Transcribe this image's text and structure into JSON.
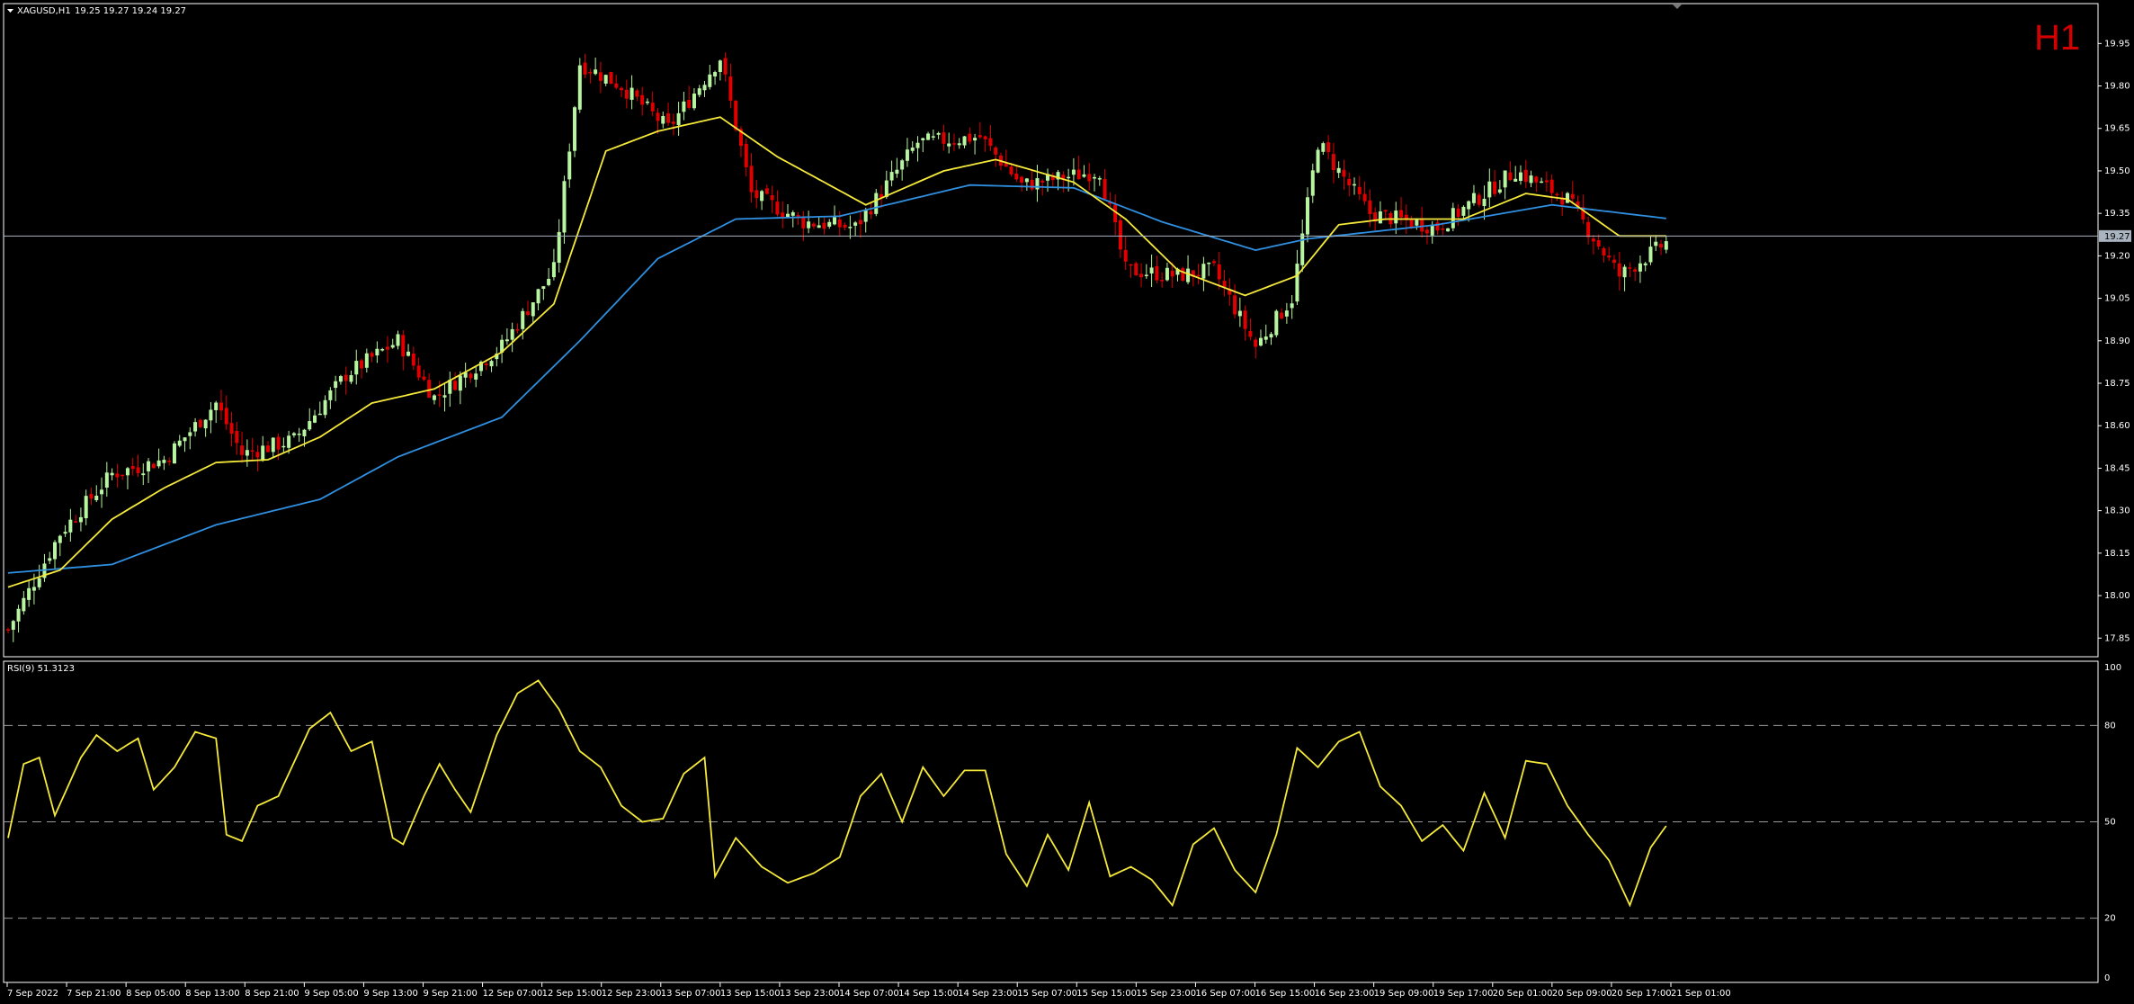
{
  "window": {
    "title": "XAGUSD,H1",
    "ohlc": "19.25 19.27 19.24 19.27",
    "timeframe": "H1"
  },
  "colors": {
    "background": "#000000",
    "bull": "#b8f5a0",
    "bear": "#e00000",
    "ma_fast": "#f5e93a",
    "ma_slow": "#2f8fe0",
    "rsi": "#f5e93a",
    "grid": "#ffffff",
    "bid_line": "#a9b4c0",
    "timeframe_label": "#d40000"
  },
  "price_axis": {
    "ticks": [
      "19.95",
      "19.80",
      "19.65",
      "19.50",
      "19.35",
      "19.20",
      "19.05",
      "18.90",
      "18.75",
      "18.60",
      "18.45",
      "18.30",
      "18.15",
      "18.00",
      "17.85"
    ],
    "min": 17.8,
    "max": 20.04,
    "current_price": "19.27"
  },
  "rsi_panel": {
    "label": "RSI(9) 51.3123",
    "ticks": [
      "100",
      "80",
      "50",
      "20",
      "0"
    ],
    "levels": [
      80,
      50,
      20
    ]
  },
  "time_axis": {
    "labels": [
      "7 Sep 2022",
      "7 Sep 21:00",
      "8 Sep 05:00",
      "8 Sep 13:00",
      "8 Sep 21:00",
      "9 Sep 05:00",
      "9 Sep 13:00",
      "9 Sep 21:00",
      "12 Sep 07:00",
      "12 Sep 15:00",
      "12 Sep 23:00",
      "13 Sep 07:00",
      "13 Sep 15:00",
      "13 Sep 23:00",
      "14 Sep 07:00",
      "14 Sep 15:00",
      "14 Sep 23:00",
      "15 Sep 07:00",
      "15 Sep 15:00",
      "15 Sep 23:00",
      "16 Sep 07:00",
      "16 Sep 15:00",
      "16 Sep 23:00",
      "19 Sep 09:00",
      "19 Sep 17:00",
      "20 Sep 01:00",
      "20 Sep 09:00",
      "20 Sep 17:00",
      "21 Sep 01:00"
    ]
  },
  "chart_data": {
    "type": "candlestick",
    "symbol": "XAGUSD",
    "timeframe": "H1",
    "ylim": [
      17.8,
      20.04
    ],
    "anchors": [
      [
        0,
        17.88
      ],
      [
        10,
        18.22
      ],
      [
        20,
        18.43
      ],
      [
        30,
        18.48
      ],
      [
        40,
        18.68
      ],
      [
        45,
        18.5
      ],
      [
        55,
        18.55
      ],
      [
        65,
        18.78
      ],
      [
        75,
        18.9
      ],
      [
        82,
        18.7
      ],
      [
        95,
        18.88
      ],
      [
        105,
        19.15
      ],
      [
        110,
        19.88
      ],
      [
        118,
        19.8
      ],
      [
        127,
        19.65
      ],
      [
        137,
        19.9
      ],
      [
        143,
        19.42
      ],
      [
        153,
        19.32
      ],
      [
        163,
        19.3
      ],
      [
        175,
        19.6
      ],
      [
        187,
        19.62
      ],
      [
        195,
        19.45
      ],
      [
        210,
        19.5
      ],
      [
        215,
        19.15
      ],
      [
        225,
        19.13
      ],
      [
        232,
        19.15
      ],
      [
        240,
        18.88
      ],
      [
        247,
        19.05
      ],
      [
        252,
        19.6
      ],
      [
        262,
        19.35
      ],
      [
        275,
        19.3
      ],
      [
        290,
        19.5
      ],
      [
        300,
        19.4
      ],
      [
        310,
        19.13
      ],
      [
        320,
        19.26
      ]
    ],
    "ma_fast_anchors": [
      [
        0,
        18.03
      ],
      [
        10,
        18.09
      ],
      [
        20,
        18.27
      ],
      [
        30,
        18.38
      ],
      [
        40,
        18.47
      ],
      [
        50,
        18.48
      ],
      [
        60,
        18.56
      ],
      [
        70,
        18.68
      ],
      [
        82,
        18.73
      ],
      [
        95,
        18.86
      ],
      [
        105,
        19.03
      ],
      [
        115,
        19.57
      ],
      [
        125,
        19.64
      ],
      [
        137,
        19.69
      ],
      [
        148,
        19.55
      ],
      [
        165,
        19.38
      ],
      [
        180,
        19.5
      ],
      [
        190,
        19.54
      ],
      [
        205,
        19.46
      ],
      [
        215,
        19.33
      ],
      [
        225,
        19.15
      ],
      [
        238,
        19.06
      ],
      [
        248,
        19.13
      ],
      [
        256,
        19.31
      ],
      [
        265,
        19.33
      ],
      [
        280,
        19.33
      ],
      [
        292,
        19.42
      ],
      [
        300,
        19.4
      ],
      [
        310,
        19.27
      ],
      [
        320,
        19.27
      ]
    ],
    "ma_slow_anchors": [
      [
        0,
        18.08
      ],
      [
        20,
        18.11
      ],
      [
        40,
        18.25
      ],
      [
        60,
        18.34
      ],
      [
        75,
        18.49
      ],
      [
        95,
        18.63
      ],
      [
        110,
        18.9
      ],
      [
        125,
        19.19
      ],
      [
        140,
        19.33
      ],
      [
        160,
        19.34
      ],
      [
        185,
        19.45
      ],
      [
        205,
        19.44
      ],
      [
        222,
        19.32
      ],
      [
        240,
        19.22
      ],
      [
        250,
        19.26
      ],
      [
        275,
        19.31
      ],
      [
        297,
        19.38
      ],
      [
        320,
        19.33
      ]
    ],
    "rsi_anchors": [
      [
        0,
        45
      ],
      [
        3,
        68
      ],
      [
        6,
        70
      ],
      [
        9,
        52
      ],
      [
        14,
        70
      ],
      [
        17,
        77
      ],
      [
        21,
        72
      ],
      [
        25,
        76
      ],
      [
        28,
        60
      ],
      [
        32,
        67
      ],
      [
        36,
        78
      ],
      [
        40,
        76
      ],
      [
        42,
        46
      ],
      [
        45,
        44
      ],
      [
        48,
        55
      ],
      [
        52,
        58
      ],
      [
        58,
        79
      ],
      [
        62,
        84
      ],
      [
        66,
        72
      ],
      [
        70,
        75
      ],
      [
        74,
        45
      ],
      [
        76,
        43
      ],
      [
        80,
        58
      ],
      [
        83,
        68
      ],
      [
        86,
        60
      ],
      [
        89,
        53
      ],
      [
        94,
        77
      ],
      [
        98,
        90
      ],
      [
        102,
        94
      ],
      [
        106,
        85
      ],
      [
        110,
        72
      ],
      [
        114,
        67
      ],
      [
        118,
        55
      ],
      [
        122,
        50
      ],
      [
        126,
        51
      ],
      [
        130,
        65
      ],
      [
        134,
        70
      ],
      [
        136,
        33
      ],
      [
        140,
        45
      ],
      [
        145,
        36
      ],
      [
        150,
        31
      ],
      [
        155,
        34
      ],
      [
        160,
        39
      ],
      [
        164,
        58
      ],
      [
        168,
        65
      ],
      [
        172,
        50
      ],
      [
        176,
        67
      ],
      [
        180,
        58
      ],
      [
        184,
        66
      ],
      [
        188,
        66
      ],
      [
        192,
        40
      ],
      [
        196,
        30
      ],
      [
        200,
        46
      ],
      [
        204,
        35
      ],
      [
        208,
        56
      ],
      [
        212,
        33
      ],
      [
        216,
        36
      ],
      [
        220,
        32
      ],
      [
        224,
        24
      ],
      [
        228,
        43
      ],
      [
        232,
        48
      ],
      [
        236,
        35
      ],
      [
        240,
        28
      ],
      [
        244,
        46
      ],
      [
        248,
        73
      ],
      [
        252,
        67
      ],
      [
        256,
        75
      ],
      [
        260,
        78
      ],
      [
        264,
        61
      ],
      [
        268,
        55
      ],
      [
        272,
        44
      ],
      [
        276,
        49
      ],
      [
        280,
        41
      ],
      [
        284,
        59
      ],
      [
        288,
        45
      ],
      [
        292,
        69
      ],
      [
        296,
        68
      ],
      [
        300,
        55
      ],
      [
        304,
        46
      ],
      [
        308,
        38
      ],
      [
        312,
        24
      ],
      [
        316,
        42
      ],
      [
        320,
        51
      ]
    ]
  }
}
